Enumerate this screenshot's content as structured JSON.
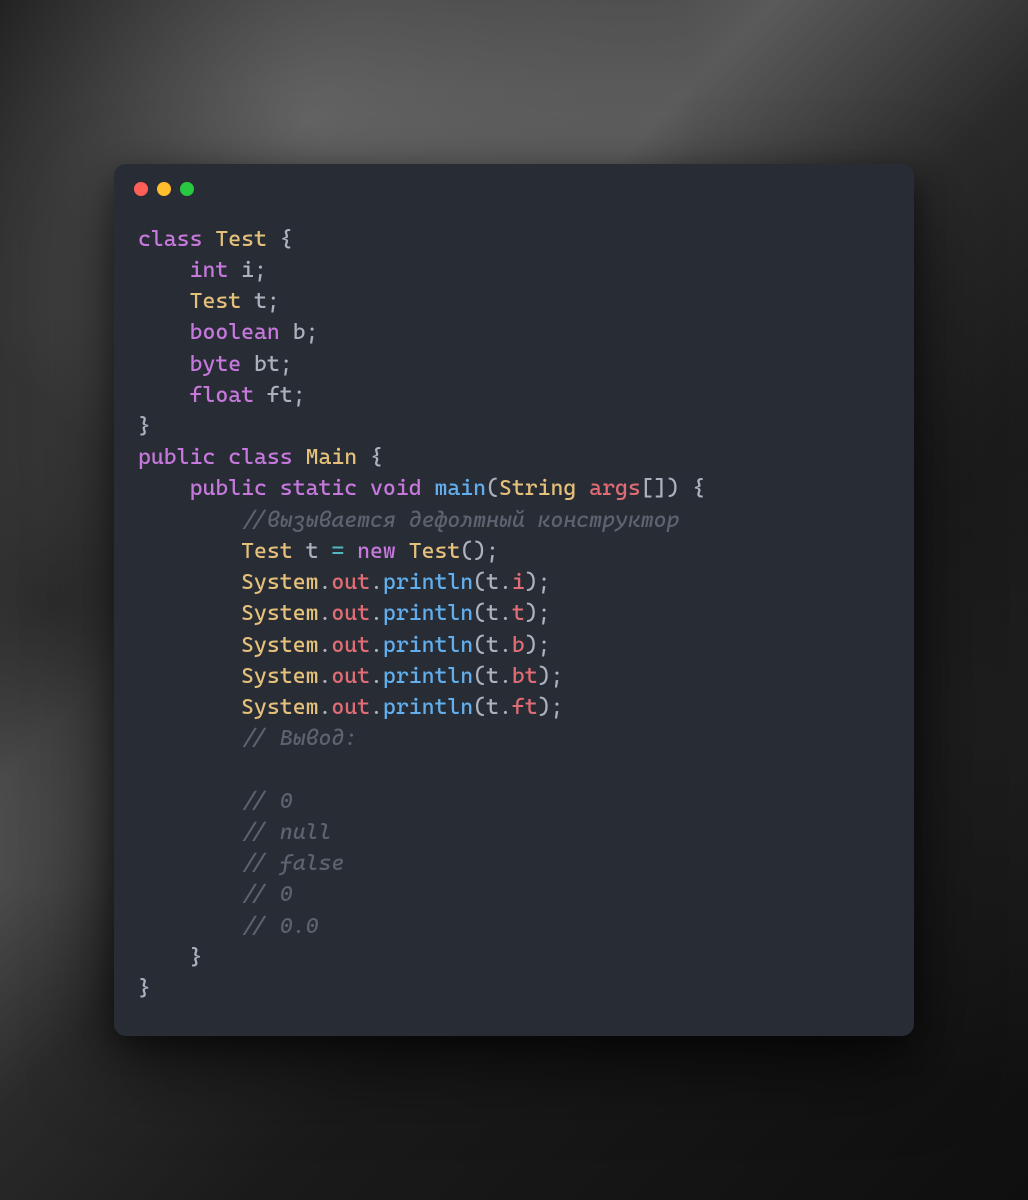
{
  "window": {
    "traffic_lights": {
      "close": "#ff5f57",
      "minimize": "#ffbd2e",
      "maximize": "#28c840"
    }
  },
  "code": {
    "l01": {
      "kw_class": "class",
      "name": "Test",
      "brace": " {"
    },
    "l02": {
      "indent": "    ",
      "type": "int",
      "var": " i",
      "punct": ";"
    },
    "l03": {
      "indent": "    ",
      "type": "Test",
      "var": " t",
      "punct": ";"
    },
    "l04": {
      "indent": "    ",
      "type": "boolean",
      "var": " b",
      "punct": ";"
    },
    "l05": {
      "indent": "    ",
      "type": "byte",
      "var": " bt",
      "punct": ";"
    },
    "l06": {
      "indent": "    ",
      "type": "float",
      "var": " ft",
      "punct": ";"
    },
    "l07": {
      "brace": "}"
    },
    "l08": {
      "kw_public": "public",
      "kw_class": " class",
      "name": " Main",
      "brace": " {"
    },
    "l09": {
      "indent": "    ",
      "kw_public": "public",
      "kw_static": " static",
      "kw_void": " void",
      "fn": " main",
      "open": "(",
      "type": "String",
      "var": " args",
      "brackets": "[]",
      "close": ")",
      "brace": " {"
    },
    "l10": {
      "indent": "        ",
      "comment": "//вызывается дефолтный конструктор"
    },
    "l11": {
      "indent": "        ",
      "type": "Test",
      "var": " t ",
      "op": "=",
      "kw_new": " new",
      "ctor": " Test",
      "call": "()",
      "punct": ";"
    },
    "l12": {
      "indent": "        ",
      "sys": "System",
      "dot1": ".",
      "out": "out",
      "dot2": ".",
      "fn": "println",
      "open": "(",
      "arg1": "t",
      "dot3": ".",
      "arg2": "i",
      "close": ")",
      "punct": ";"
    },
    "l13": {
      "indent": "        ",
      "sys": "System",
      "dot1": ".",
      "out": "out",
      "dot2": ".",
      "fn": "println",
      "open": "(",
      "arg1": "t",
      "dot3": ".",
      "arg2": "t",
      "close": ")",
      "punct": ";"
    },
    "l14": {
      "indent": "        ",
      "sys": "System",
      "dot1": ".",
      "out": "out",
      "dot2": ".",
      "fn": "println",
      "open": "(",
      "arg1": "t",
      "dot3": ".",
      "arg2": "b",
      "close": ")",
      "punct": ";"
    },
    "l15": {
      "indent": "        ",
      "sys": "System",
      "dot1": ".",
      "out": "out",
      "dot2": ".",
      "fn": "println",
      "open": "(",
      "arg1": "t",
      "dot3": ".",
      "arg2": "bt",
      "close": ")",
      "punct": ";"
    },
    "l16": {
      "indent": "        ",
      "sys": "System",
      "dot1": ".",
      "out": "out",
      "dot2": ".",
      "fn": "println",
      "open": "(",
      "arg1": "t",
      "dot3": ".",
      "arg2": "ft",
      "close": ")",
      "punct": ";"
    },
    "l17": {
      "indent": "        ",
      "comment": "// Вывод:"
    },
    "l18": {
      "blank": ""
    },
    "l19": {
      "indent": "        ",
      "comment": "// 0"
    },
    "l20": {
      "indent": "        ",
      "comment": "// null"
    },
    "l21": {
      "indent": "        ",
      "comment": "// false"
    },
    "l22": {
      "indent": "        ",
      "comment": "// 0"
    },
    "l23": {
      "indent": "        ",
      "comment": "// 0.0"
    },
    "l24": {
      "indent": "    ",
      "brace": "}"
    },
    "l25": {
      "brace": "}"
    }
  }
}
